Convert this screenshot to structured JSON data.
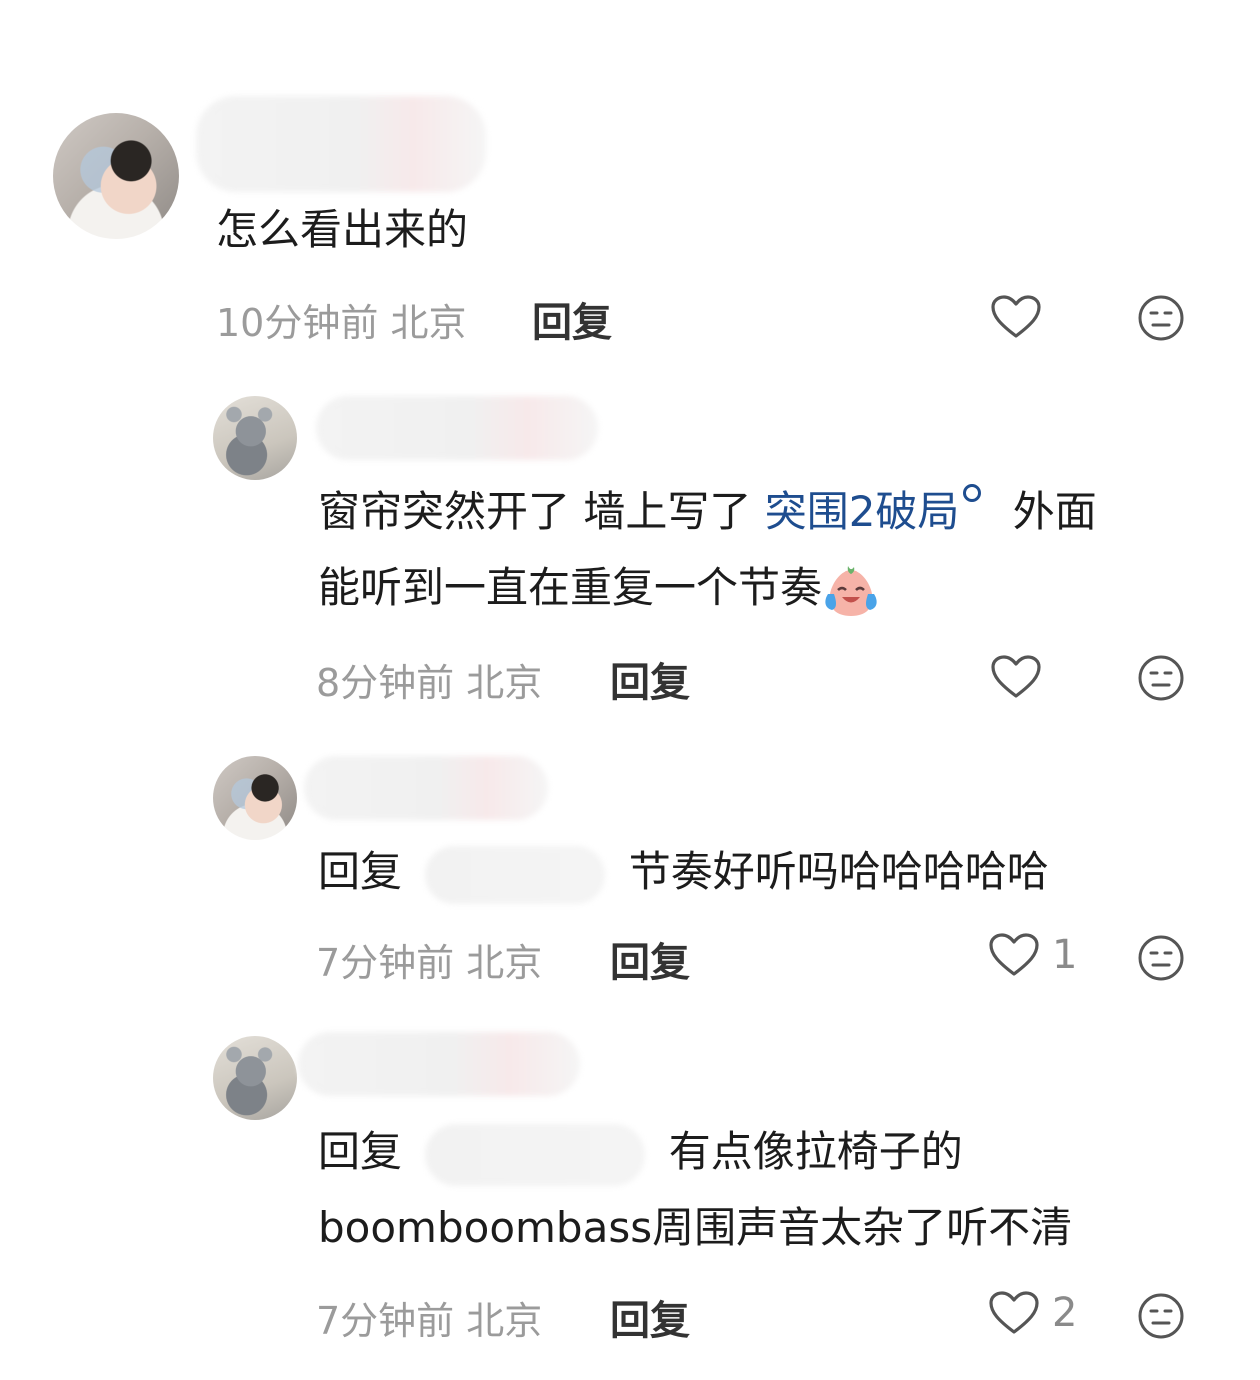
{
  "comments": [
    {
      "text": "怎么看出来的",
      "time": "10分钟前",
      "location": "北京",
      "reply_label": "回复",
      "likes": "",
      "avatar_icon": "avatar-girl",
      "like_icon": "heart-icon",
      "react_icon": "meh-face-icon"
    },
    {
      "text_before": "窗帘突然开了 墙上写了 ",
      "link": "突围2破局",
      "text_after": " 外面",
      "text_line2": "能听到一直在重复一个节奏",
      "emoji_icon": "laugh-cry-emoji",
      "time": "8分钟前",
      "location": "北京",
      "reply_label": "回复",
      "likes": "",
      "avatar_icon": "avatar-cat"
    },
    {
      "prefix": "回复",
      "text": "节奏好听吗哈哈哈哈哈",
      "time": "7分钟前",
      "location": "北京",
      "reply_label": "回复",
      "likes": "1",
      "avatar_icon": "avatar-girl"
    },
    {
      "prefix": "回复",
      "text": "有点像拉椅子的",
      "text_line2": "boomboombass周围声音太杂了听不清",
      "time": "7分钟前",
      "location": "北京",
      "reply_label": "回复",
      "likes": "2",
      "avatar_icon": "avatar-cat"
    }
  ]
}
